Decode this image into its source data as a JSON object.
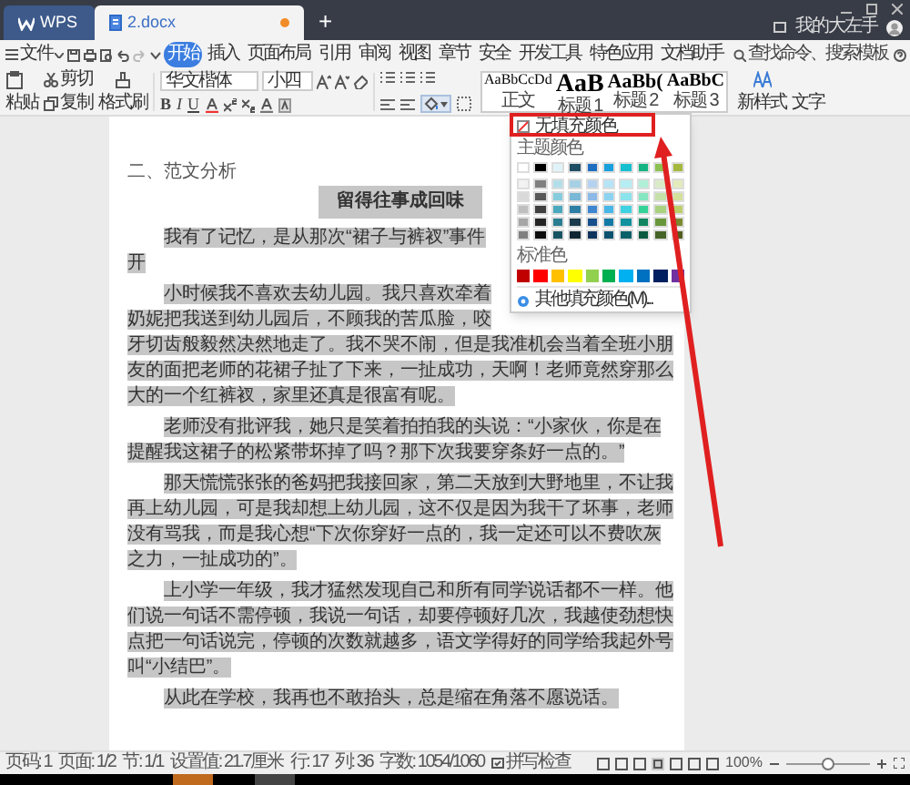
{
  "title_bar": {
    "tabs": [
      {
        "label": "WPS",
        "kind": "home",
        "selected": false,
        "unsaved": false
      },
      {
        "label": "2.docx",
        "kind": "doc",
        "selected": true,
        "unsaved": true
      }
    ],
    "new_tab": "+",
    "user": "我的大左手"
  },
  "menu": {
    "file": "文件",
    "tabs": [
      {
        "label": "开始",
        "selected": true
      },
      {
        "label": "插入",
        "selected": false
      },
      {
        "label": "页面布局",
        "selected": false
      },
      {
        "label": "引用",
        "selected": false
      },
      {
        "label": "审阅",
        "selected": false
      },
      {
        "label": "视图",
        "selected": false
      },
      {
        "label": "章节",
        "selected": false
      },
      {
        "label": "安全",
        "selected": false
      },
      {
        "label": "开发工具",
        "selected": false
      },
      {
        "label": "特色应用",
        "selected": false
      },
      {
        "label": "文档助手",
        "selected": false
      }
    ],
    "search": "查找命令、搜索模板"
  },
  "ribbon": {
    "paste": "粘贴",
    "cut": "剪切",
    "copy": "复制",
    "format_painter": "格式刷",
    "font": "华文楷体",
    "size": "小四",
    "format_buttons": [
      "B",
      "I",
      "U"
    ],
    "styles": [
      {
        "preview": "AaBbCcDd",
        "label": "正文",
        "kind": "body"
      },
      {
        "preview": "AaB",
        "label": "标题 1",
        "kind": "h1"
      },
      {
        "preview": "AaBb(",
        "label": "标题 2",
        "kind": "h2"
      },
      {
        "preview": "AaBbC",
        "label": "标题 3",
        "kind": "h3"
      }
    ],
    "new_style": "新样式",
    "text_tool": "文字"
  },
  "document": {
    "heading": "二、范文分析",
    "title": "留得往事成回味",
    "paragraphs": [
      "我有了记忆，是从那次“裙子与裤衩”事件开",
      "小时候我不喜欢去幼儿园。我只喜欢牵着奶妮把我送到幼儿园后，不顾我的苦瓜脸，咬牙切齿般毅然决然地走了。我不哭不闹，但是我准机会当着全班小朋友的面把老师的花裙子扯了下来，一扯成功，天啊！老师竟然穿那么大的一个红裤衩，家里还真是很富有呢。",
      "老师没有批评我，她只是笑着拍拍我的头说：“小家伙，你是在提醒我这裙子的松紧带坏掉了吗？那下次我要穿条好一点的。”",
      "那天慌慌张张的爸妈把我接回家，第二天放到大野地里，不让我再上幼儿园，可是我却想上幼儿园，这不仅是因为我干了坏事，老师没有骂我，而是我心想“下次你穿好一点的，我一定还可以不费吹灰之力，一扯成功的”。",
      "上小学一年级，我才猛然发现自己和所有同学说话都不一样。他们说一句话不需停顿，我说一句话，却要停顿好几次，我越使劲想快点把一句话说完，停顿的次数就越多，语文学得好的同学给我起外号叫“小结巴”。",
      "从此在学校，我再也不敢抬头，总是缩在角落不愿说话。"
    ]
  },
  "fill_menu": {
    "no_fill": "无填充颜色",
    "theme_label": "主题颜色",
    "theme_colors": [
      {
        "swatches": [
          {
            "color": "#ffffff"
          },
          {
            "color": "#000000"
          },
          {
            "color": "#e0f3f8"
          },
          {
            "color": "#1f4e64"
          },
          {
            "color": "#1f6fc0"
          },
          {
            "color": "#1aa0dc"
          },
          {
            "color": "#15bfcf"
          },
          {
            "color": "#16b383"
          },
          {
            "color": "#8cc152"
          },
          {
            "color": "#a3b83d"
          }
        ]
      },
      {
        "swatches": [
          {
            "color": "#f2f2f2"
          },
          {
            "color": "#808080"
          },
          {
            "color": "#b3dfea"
          },
          {
            "color": "#a6d0e4"
          },
          {
            "color": "#b5d2f0"
          },
          {
            "color": "#b6e3f6"
          },
          {
            "color": "#b4edf3"
          },
          {
            "color": "#b0efd8"
          },
          {
            "color": "#d9ebc6"
          },
          {
            "color": "#e3ebbc"
          }
        ]
      },
      {
        "swatches": [
          {
            "color": "#d9d9d9"
          },
          {
            "color": "#595959"
          },
          {
            "color": "#86ccdd"
          },
          {
            "color": "#79b8d6"
          },
          {
            "color": "#8cb9e8"
          },
          {
            "color": "#8dd3f1"
          },
          {
            "color": "#8be3ec"
          },
          {
            "color": "#85e6c2"
          },
          {
            "color": "#c5e0a9"
          },
          {
            "color": "#d4e19b"
          }
        ]
      },
      {
        "swatches": [
          {
            "color": "#bfbfbf"
          },
          {
            "color": "#404040"
          },
          {
            "color": "#4aa8bf"
          },
          {
            "color": "#2e7fa6"
          },
          {
            "color": "#3f85d0"
          },
          {
            "color": "#48b7e7"
          },
          {
            "color": "#3fd2e2"
          },
          {
            "color": "#35d398"
          },
          {
            "color": "#a9d17f"
          },
          {
            "color": "#bccf6a"
          }
        ]
      },
      {
        "swatches": [
          {
            "color": "#a6a6a6"
          },
          {
            "color": "#262626"
          },
          {
            "color": "#2a7d91"
          },
          {
            "color": "#1a3b4b"
          },
          {
            "color": "#174f8c"
          },
          {
            "color": "#137aa6"
          },
          {
            "color": "#0f919e"
          },
          {
            "color": "#108560"
          },
          {
            "color": "#68963a"
          },
          {
            "color": "#7a8a2e"
          }
        ]
      },
      {
        "swatches": [
          {
            "color": "#808080"
          },
          {
            "color": "#0d0d0d"
          },
          {
            "color": "#185361"
          },
          {
            "color": "#0f2732"
          },
          {
            "color": "#0f345d"
          },
          {
            "color": "#0d516f"
          },
          {
            "color": "#0a6069"
          },
          {
            "color": "#0b5940"
          },
          {
            "color": "#456427"
          },
          {
            "color": "#515c1e"
          }
        ]
      }
    ],
    "standard_label": "标准色",
    "standard_colors": [
      {
        "color": "#c00000"
      },
      {
        "color": "#ff0000"
      },
      {
        "color": "#ffc000"
      },
      {
        "color": "#ffff00"
      },
      {
        "color": "#92d050"
      },
      {
        "color": "#00b050"
      },
      {
        "color": "#00b0f0"
      },
      {
        "color": "#0070c0"
      },
      {
        "color": "#002060"
      },
      {
        "color": "#7030a0"
      }
    ],
    "more": "其他填充颜色(M)..."
  },
  "status_bar": {
    "items": [
      "页码: 1",
      "页面: 1/2",
      "节: 1/1",
      "设置值: 21.7厘米",
      "行: 17",
      "列: 36",
      "字数: 1054/1060"
    ],
    "spell_check": "拼写检查",
    "zoom": "100%",
    "zoom_slider": {
      "level": 0.5
    }
  }
}
